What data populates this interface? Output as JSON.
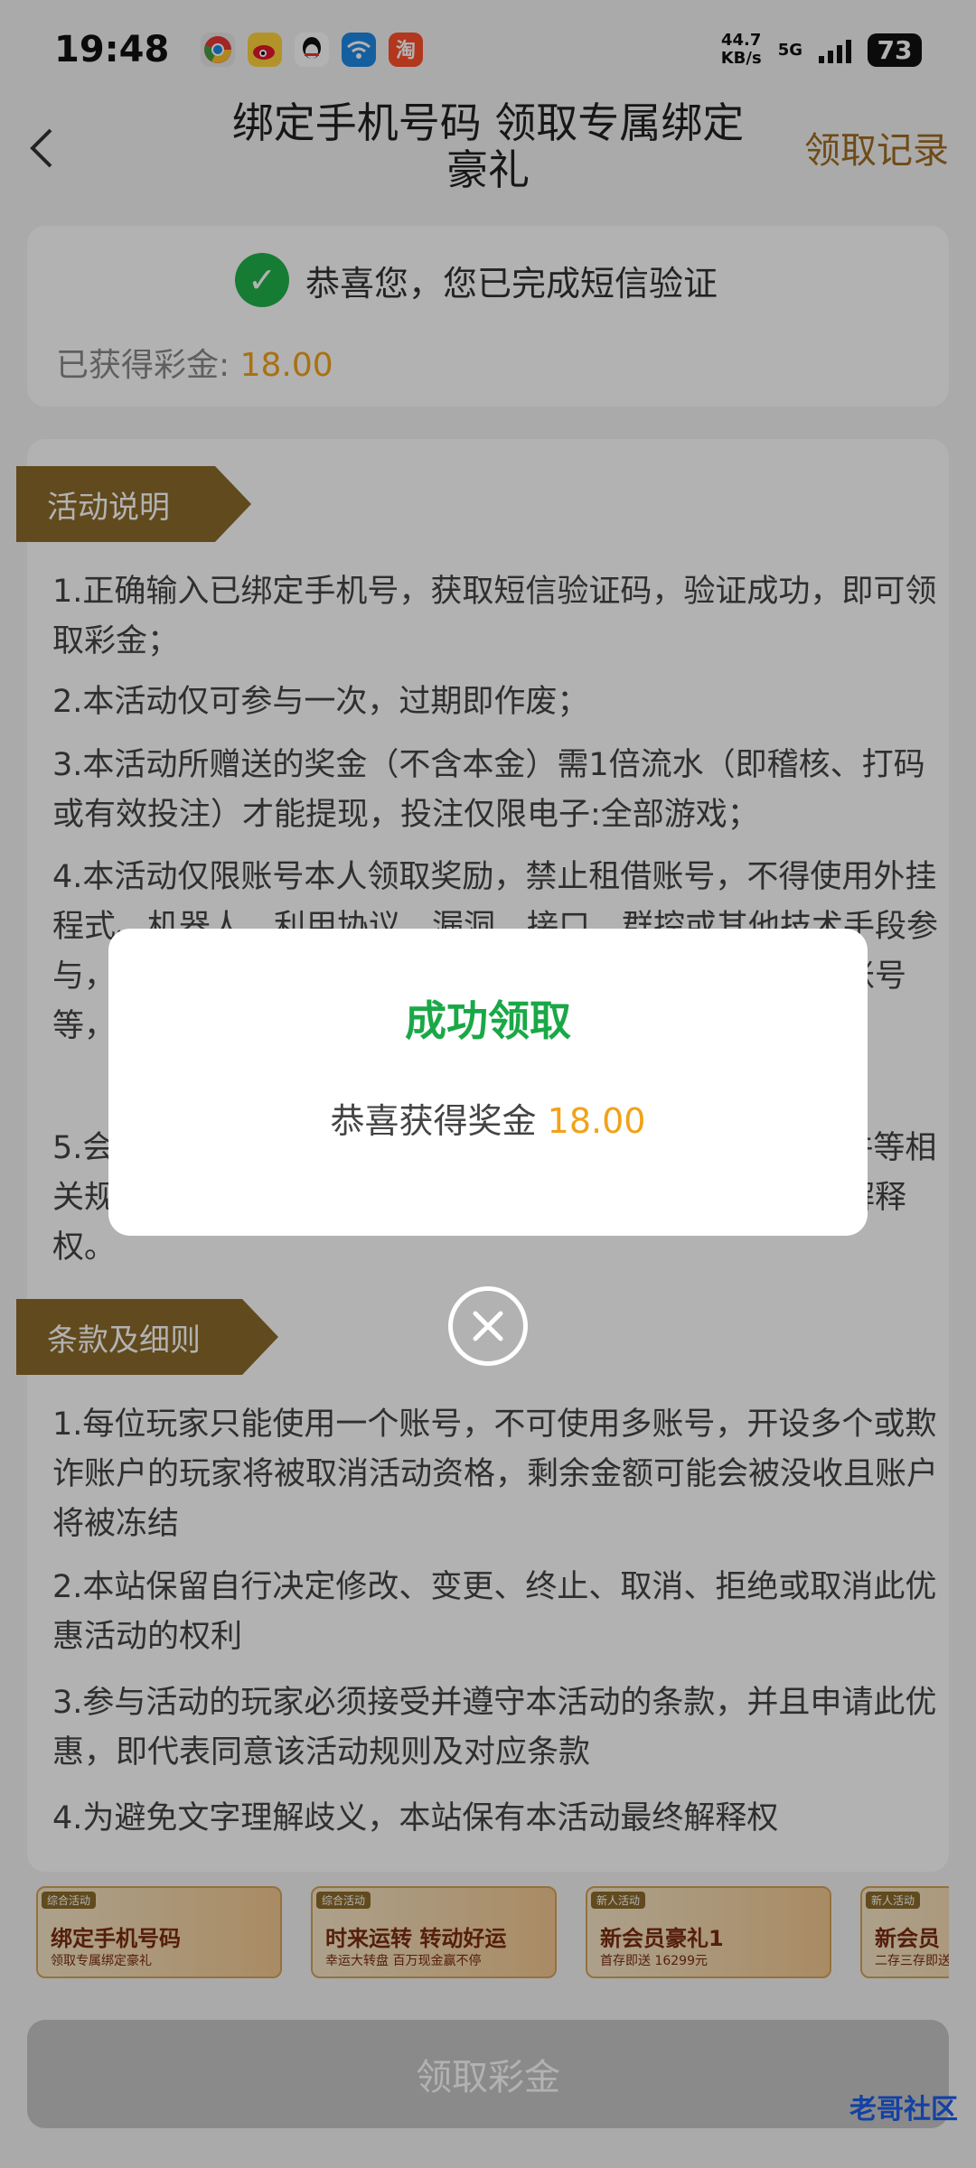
{
  "status_bar": {
    "time": "19:48",
    "speed_value": "44.7",
    "speed_unit": "KB/s",
    "network": "5G",
    "battery": "73"
  },
  "header": {
    "title": "绑定手机号码 领取专属绑定豪礼",
    "records": "领取记录"
  },
  "verify": {
    "message": "恭喜您，您已完成短信验证",
    "earned_label": "已获得彩金: ",
    "earned_value": "18.00"
  },
  "activity": {
    "tag": "活动说明",
    "items": [
      "1.正确输入已绑定手机号，获取短信验证码，验证成功，即可领取彩金；",
      "2.本活动仅可参与一次，过期即作废；",
      "3.本活动所赠送的奖金（不含本金）需1倍流水（即稽核、打码或有效投注）才能提现，投注仅限电子:全部游戏；",
      "4.本活动仅限账号本人领取奖励，禁止租借账号，不得使用外挂程式、机器人、利用协议、漏洞、接口、群控或其他技术手段参与，否则将取消或扣除奖励、冻结，甚至拉黑，暂停会员账号等，平台有权在活动结束前修改或终止，不另行通知；",
      "5.会员参加本平台活动的同时，需遵守平台相关政策与条件等相关规定，本平台对此次活动拥有最终解释权、修改和最终解释权。"
    ]
  },
  "terms": {
    "tag": "条款及细则",
    "items": [
      "1.每位玩家只能使用一个账号，不可使用多账号，开设多个或欺诈账户的玩家将被取消活动资格，剩余金额可能会被没收且账户将被冻结",
      "2.本站保留自行决定修改、变更、终止、取消、拒绝或取消此优惠活动的权利",
      "3.参与活动的玩家必须接受并遵守本活动的条款，并且申请此优惠，即代表同意该活动规则及对应条款",
      "4.为避免文字理解歧义，本站保有本活动最终解释权"
    ]
  },
  "banners": [
    {
      "tag": "综合活动",
      "title": "绑定手机号码",
      "sub": "领取专属绑定豪礼"
    },
    {
      "tag": "综合活动",
      "title": "时来运转 转动好运",
      "sub": "幸运大转盘 百万现金赢不停"
    },
    {
      "tag": "新人活动",
      "title": "新会员豪礼1",
      "sub": "首存即送 16299元"
    },
    {
      "tag": "新人活动",
      "title": "新会员",
      "sub": "二存三存即送"
    }
  ],
  "bottom": {
    "claim_label": "领取彩金",
    "watermark": "老哥社区"
  },
  "dialog": {
    "title": "成功领取",
    "message": "恭喜获得奖金 ",
    "amount": "18.00"
  },
  "colors": {
    "accent_brown": "#8c6a2a",
    "gold": "#f2a217",
    "success_green": "#1aa847"
  }
}
